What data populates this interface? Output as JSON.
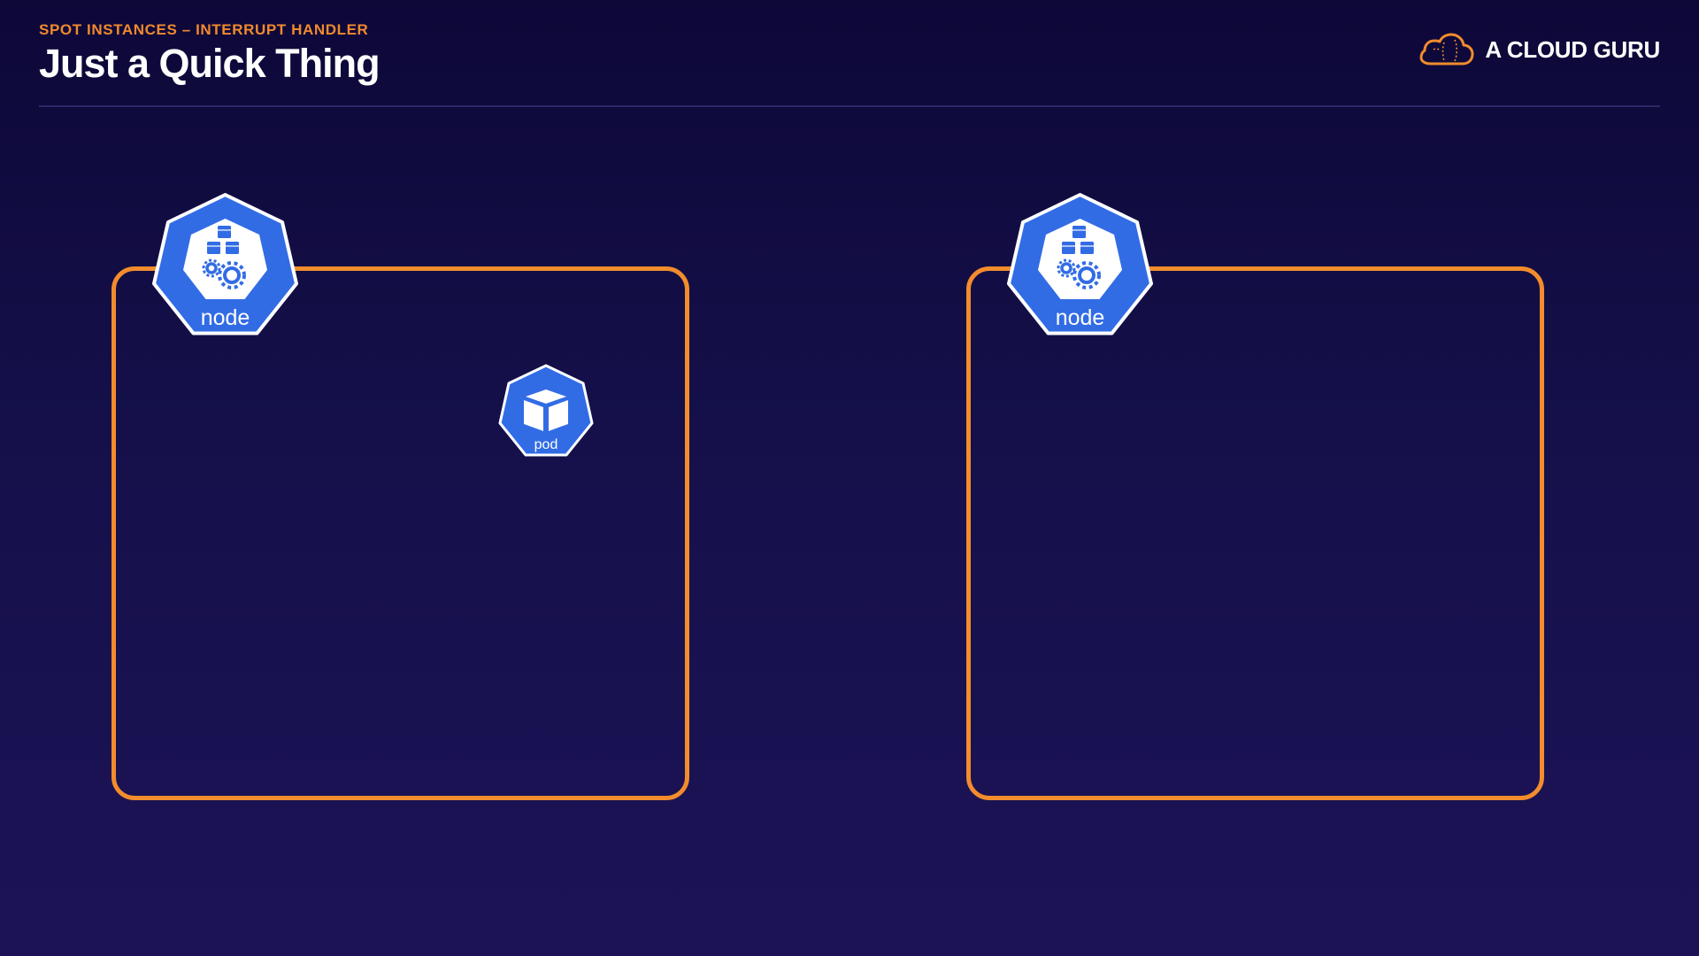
{
  "header": {
    "subtitle": "SPOT INSTANCES – INTERRUPT HANDLER",
    "title": "Just a Quick Thing"
  },
  "brand": {
    "name": "A CLOUD GURU",
    "icon": "cloud-logo-icon"
  },
  "diagram": {
    "nodes": [
      {
        "label": "node",
        "icon": "kubernetes-node-icon",
        "pods": [
          "pod"
        ]
      },
      {
        "label": "node",
        "icon": "kubernetes-node-icon",
        "pods": []
      }
    ],
    "pod_icon": "kubernetes-pod-icon"
  },
  "colors": {
    "accent": "#f28c2c",
    "k8s_blue": "#326ce5",
    "background_top": "#0d0838",
    "background_bottom": "#1c1357",
    "text": "#ffffff"
  }
}
